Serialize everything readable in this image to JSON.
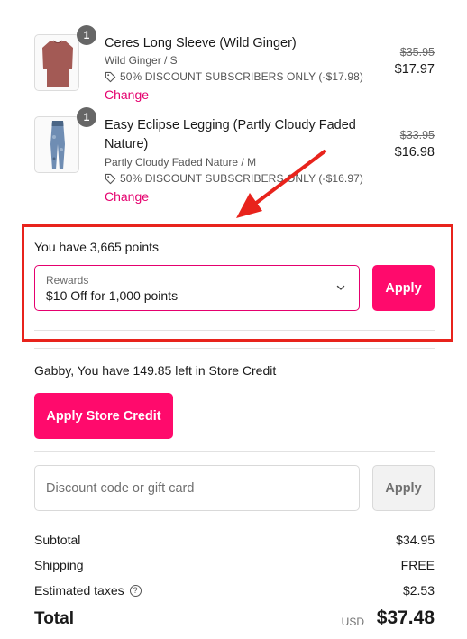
{
  "items": [
    {
      "name": "Ceres Long Sleeve (Wild Ginger)",
      "variant": "Wild Ginger / S",
      "discount": "50% DISCOUNT SUBSCRIBERS ONLY (-$17.98)",
      "change_label": "Change",
      "original_price": "$35.95",
      "price": "$17.97",
      "quantity": "1",
      "image_icon": "shirt-image",
      "image_color": "#a35a55"
    },
    {
      "name_line1": "Easy Eclipse Legging (Partly Cloudy Faded",
      "name_line2": "Nature)",
      "variant": "Partly Cloudy Faded Nature / M",
      "discount": "50% DISCOUNT SUBSCRIBERS ONLY (-$16.97)",
      "change_label": "Change",
      "original_price": "$33.95",
      "price": "$16.98",
      "quantity": "1",
      "image_icon": "legging-image",
      "image_color": "#6f8db3"
    }
  ],
  "rewards": {
    "points_text": "You have 3,665 points",
    "select_label": "Rewards",
    "selected_option": "$10 Off for 1,000 points",
    "apply_label": "Apply"
  },
  "store_credit": {
    "text": "Gabby, You have 149.85 left in Store Credit",
    "button_label": "Apply Store Credit"
  },
  "discount": {
    "placeholder": "Discount code or gift card",
    "apply_label": "Apply"
  },
  "summary": {
    "subtotal_label": "Subtotal",
    "subtotal_value": "$34.95",
    "shipping_label": "Shipping",
    "shipping_value": "FREE",
    "taxes_label": "Estimated taxes",
    "taxes_value": "$2.53",
    "total_label": "Total",
    "currency": "USD",
    "total_value": "$37.48"
  },
  "colors": {
    "accent": "#ff0a6c",
    "link": "#e5006e",
    "annotation": "#e8231c"
  }
}
